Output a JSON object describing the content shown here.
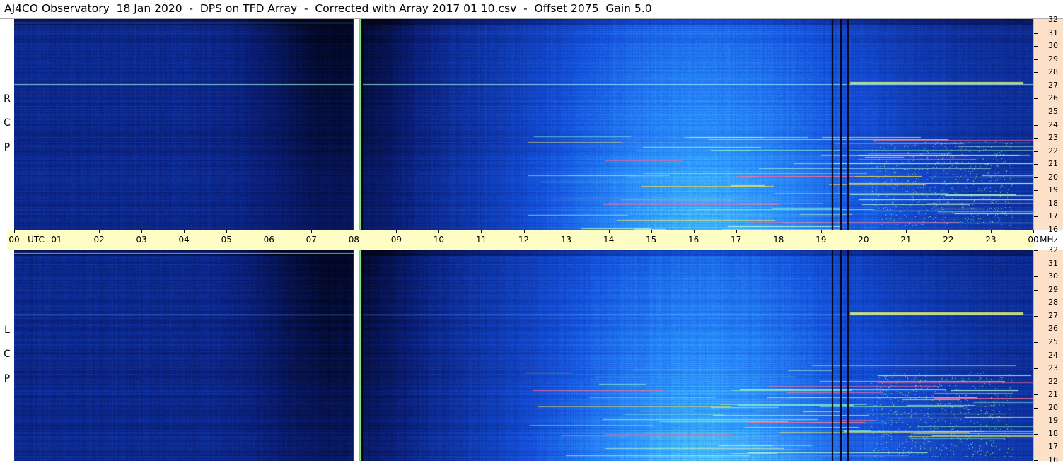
{
  "title": "AJ4CO Observatory  18 Jan 2020  -  DPS on TFD Array  -  Corrected with Array 2017 01 10.csv  -  Offset 2075  Gain 5.0",
  "panels": [
    {
      "id": "rcp",
      "label": [
        "R",
        "C",
        "P"
      ]
    },
    {
      "id": "lcp",
      "label": [
        "L",
        "C",
        "P"
      ]
    }
  ],
  "freq_axis": {
    "unit": "MHz",
    "min": 16,
    "max": 32,
    "ticks": [
      "32",
      "31",
      "30",
      "29",
      "28",
      "27",
      "26",
      "25",
      "24",
      "23",
      "22",
      "21",
      "20",
      "19",
      "18",
      "17",
      "16"
    ]
  },
  "time_axis": {
    "labels": [
      "00",
      "UTC",
      "01",
      "02",
      "03",
      "04",
      "05",
      "06",
      "07",
      "08",
      "09",
      "10",
      "11",
      "12",
      "13",
      "14",
      "15",
      "16",
      "17",
      "18",
      "19",
      "20",
      "21",
      "22",
      "23",
      "00",
      "MHz"
    ],
    "hours": [
      "00",
      "01",
      "02",
      "03",
      "04",
      "05",
      "06",
      "07",
      "08",
      "09",
      "10",
      "11",
      "12",
      "13",
      "14",
      "15",
      "16",
      "17",
      "18",
      "19",
      "20",
      "21",
      "22",
      "23",
      "00"
    ],
    "utc_label": "UTC",
    "unit_label": "MHz"
  },
  "colors": {
    "night": "#020825",
    "low": "#0a2a8a",
    "mid": "#1e6fe0",
    "day": "#3aa8ff",
    "hot": "#6ff0d8",
    "burst": "#ffe84a",
    "axis_bg": "#fde0c8",
    "time_bg": "#fdfdc4"
  }
}
